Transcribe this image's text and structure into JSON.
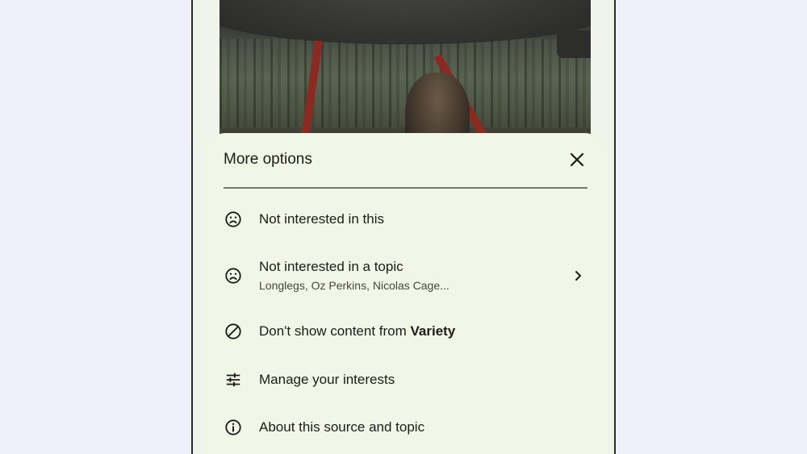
{
  "sheet": {
    "title": "More options",
    "close_icon": "close-icon"
  },
  "menu": {
    "items": [
      {
        "label": "Not interested in this",
        "icon": "sad-face-icon"
      },
      {
        "label": "Not interested in a topic",
        "sublabel": "Longlegs, Oz Perkins, Nicolas Cage...",
        "icon": "sad-face-icon",
        "trailing_icon": "chevron-right-icon"
      },
      {
        "label_prefix": "Don't show content from ",
        "label_source": "Variety",
        "icon": "block-icon"
      },
      {
        "label": "Manage your interests",
        "icon": "tune-icon"
      },
      {
        "label": "About this source and topic",
        "icon": "info-icon"
      }
    ]
  },
  "colors": {
    "page_background": "#eef1fa",
    "sheet_background": "#f2f6e6",
    "text_primary": "#1c1c1a",
    "divider": "#74786f"
  }
}
